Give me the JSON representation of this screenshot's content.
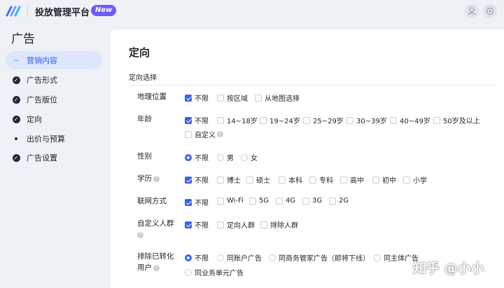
{
  "header": {
    "app_title": "投放管理平台",
    "new_badge": "New",
    "icons": [
      "user-icon",
      "settings-icon"
    ]
  },
  "sidebar": {
    "title": "广告",
    "items": [
      {
        "label": "营销内容",
        "state": "in-progress",
        "active": true
      },
      {
        "label": "广告形式",
        "state": "done"
      },
      {
        "label": "广告版位",
        "state": "done"
      },
      {
        "label": "定向",
        "state": "done"
      },
      {
        "label": "出价与预算",
        "state": "pending"
      },
      {
        "label": "广告设置",
        "state": "done"
      }
    ]
  },
  "main": {
    "title": "定向",
    "section_label": "定向选择",
    "rows": [
      {
        "label": "地理位置",
        "type": "checkbox",
        "options": [
          {
            "label": "不限",
            "selected": true
          },
          {
            "label": "按区域",
            "selected": false
          },
          {
            "label": "从地图选择",
            "selected": false
          }
        ]
      },
      {
        "label": "年龄",
        "type": "checkbox",
        "options": [
          {
            "label": "不限",
            "selected": true
          },
          {
            "label": "14~18岁",
            "selected": false
          },
          {
            "label": "19~24岁",
            "selected": false
          },
          {
            "label": "25~29岁",
            "selected": false
          },
          {
            "label": "30~39岁",
            "selected": false
          },
          {
            "label": "40~49岁",
            "selected": false
          },
          {
            "label": "50岁及以上",
            "selected": false
          },
          {
            "label": "自定义",
            "selected": false
          }
        ]
      },
      {
        "label": "性别",
        "type": "radio",
        "options": [
          {
            "label": "不限",
            "selected": true
          },
          {
            "label": "男",
            "selected": false
          },
          {
            "label": "女",
            "selected": false
          }
        ]
      },
      {
        "label": "学历",
        "type": "checkbox",
        "options": [
          {
            "label": "不限",
            "selected": true
          },
          {
            "label": "博士",
            "selected": false
          },
          {
            "label": "硕士",
            "selected": false
          },
          {
            "label": "本科",
            "selected": false
          },
          {
            "label": "专科",
            "selected": false
          },
          {
            "label": "高中",
            "selected": false
          },
          {
            "label": "初中",
            "selected": false
          },
          {
            "label": "小学",
            "selected": false
          }
        ]
      },
      {
        "label": "联网方式",
        "type": "checkbox",
        "options": [
          {
            "label": "不限",
            "selected": true
          },
          {
            "label": "Wi-Fi",
            "selected": false
          },
          {
            "label": "5G",
            "selected": false
          },
          {
            "label": "4G",
            "selected": false
          },
          {
            "label": "3G",
            "selected": false
          },
          {
            "label": "2G",
            "selected": false
          }
        ]
      },
      {
        "label": "自定义人群",
        "type": "checkbox",
        "options": [
          {
            "label": "不限",
            "selected": true
          },
          {
            "label": "定向人群",
            "selected": false
          },
          {
            "label": "排除人群",
            "selected": false
          }
        ]
      },
      {
        "label_line1": "排除已转化",
        "label_line2": "用户",
        "type": "radio",
        "options": [
          {
            "label": "不限",
            "selected": true
          },
          {
            "label": "同账户广告",
            "selected": false
          },
          {
            "label": "同商务管家广告（即将下线）",
            "selected": false
          },
          {
            "label": "同主体广告",
            "selected": false
          },
          {
            "label": "同业务单元广告",
            "selected": false
          }
        ]
      }
    ]
  },
  "watermark": "知乎 @小小"
}
